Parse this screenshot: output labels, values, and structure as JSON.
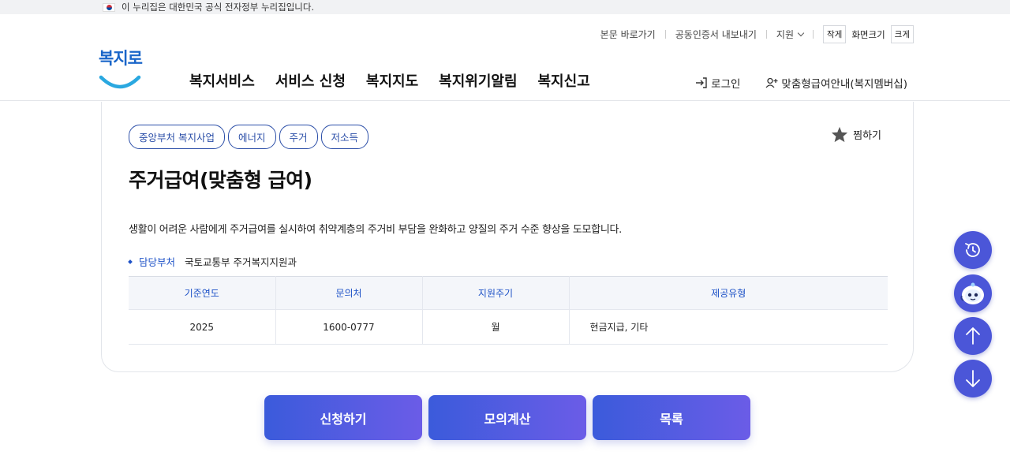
{
  "gov_banner": {
    "text": "이 누리집은 대한민국 공식 전자정부 누리집입니다."
  },
  "util": {
    "skip": "본문 바로가기",
    "cert": "공동인증서 내보내기",
    "lang": "지원",
    "font_small": "작게",
    "font_label": "화면크기",
    "font_large": "크게"
  },
  "logo": {
    "text": "복지로"
  },
  "nav": [
    "복지서비스",
    "서비스 신청",
    "복지지도",
    "복지위기알림",
    "복지신고"
  ],
  "member": {
    "login": "로그인",
    "membership": "맞춤형급여안내(복지멤버십)"
  },
  "service": {
    "tags": [
      "중앙부처 복지사업",
      "에너지",
      "주거",
      "저소득"
    ],
    "favorite": "찜하기",
    "title": "주거급여(맞춤형 급여)",
    "description": "생활이 어려운 사람에게 주거급여를 실시하여 취약계층의 주거비 부담을 완화하고 양질의 주거 수준 향상을 도모합니다.",
    "dept_label": "담당부처",
    "dept_value": "국토교통부 주거복지지원과",
    "table": {
      "headers": [
        "기준연도",
        "문의처",
        "지원주기",
        "제공유형"
      ],
      "row": [
        "2025",
        "1600-0777",
        "월",
        "현금지급, 기타"
      ]
    }
  },
  "actions": {
    "apply": "신청하기",
    "simulate": "모의계산",
    "list": "목록"
  },
  "floating": [
    "history-icon",
    "chatbot-icon",
    "arrow-up-icon",
    "arrow-down-icon"
  ],
  "colors": {
    "primary": "#1e52c7",
    "button_start": "#3b5bdb",
    "button_end": "#6b5ce7",
    "float": "#4b56d8"
  }
}
